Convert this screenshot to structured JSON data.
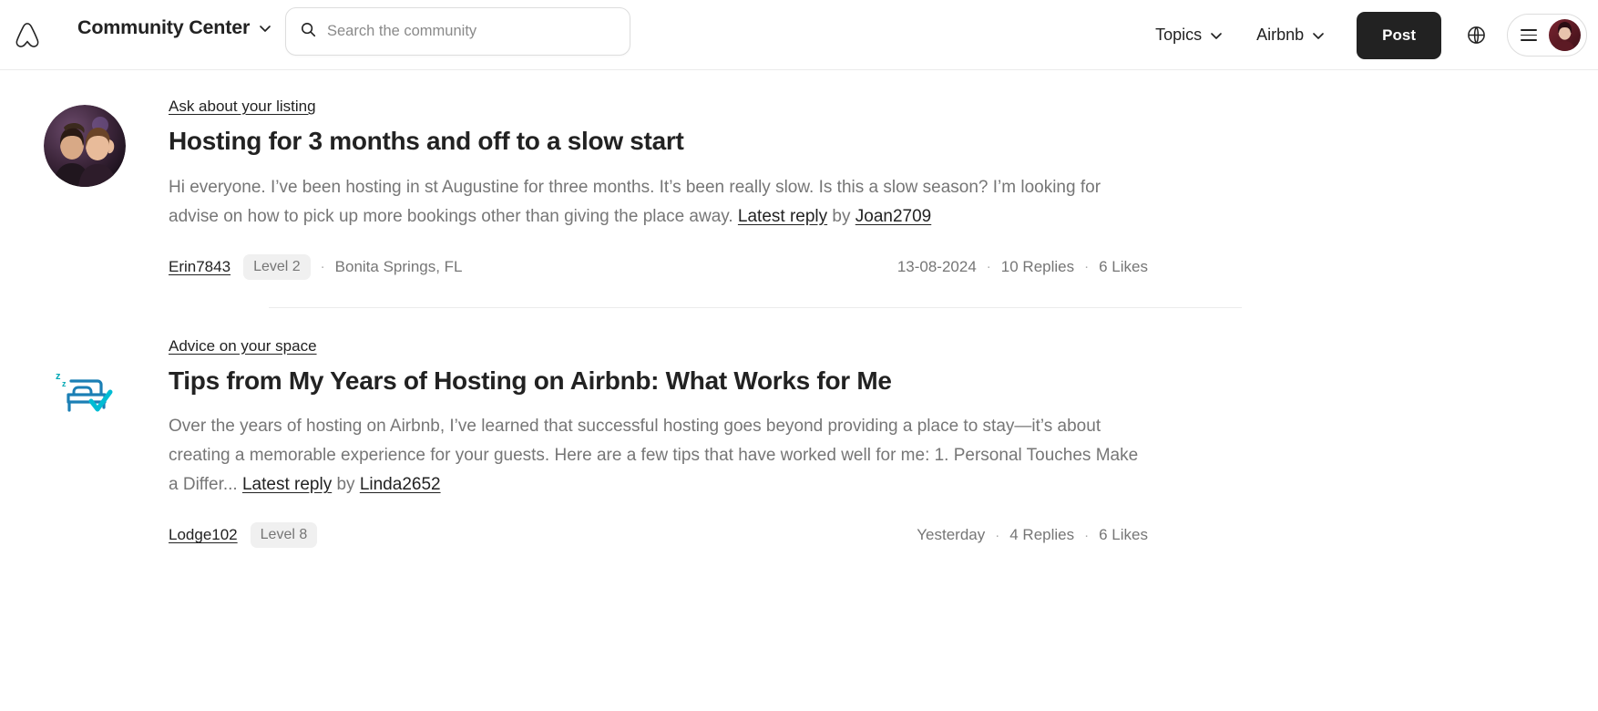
{
  "header": {
    "logo_icon": "airbnb-logo-icon",
    "brand_title": "Community Center",
    "brand_chevron_icon": "chevron-down-icon",
    "search": {
      "icon": "search-icon",
      "placeholder": "Search the community",
      "value": ""
    },
    "nav": [
      {
        "label": "Topics",
        "icon": "chevron-down-icon"
      },
      {
        "label": "Airbnb",
        "icon": "chevron-down-icon"
      }
    ],
    "post_button": "Post",
    "globe_icon": "globe-icon",
    "menu_icon": "hamburger-menu-icon",
    "avatar_icon": "user-avatar"
  },
  "feed": {
    "posts": [
      {
        "media_type": "avatar",
        "category": "Ask about your listing",
        "title": "Hosting for 3 months and off to a slow start",
        "excerpt_text": "Hi everyone. I’ve been hosting in st Augustine for three months. It’s been really slow. Is this a slow season? I’m looking for advise on how to pick up more bookings other than giving the place away. ",
        "latest_reply_label": "Latest reply",
        "by_label": " by ",
        "reply_author": "Joan2709",
        "author": "Erin7843",
        "level": "Level 2",
        "location": "Bonita Springs, FL",
        "date": "13-08-2024",
        "replies": "10 Replies",
        "likes": "6 Likes"
      },
      {
        "media_type": "icon",
        "media_icon": "bed-sleep-check-icon",
        "category": "Advice on your space",
        "title": "Tips from My Years of Hosting on Airbnb: What Works for Me",
        "excerpt_text": "Over the years of hosting on Airbnb, I’ve learned that successful hosting goes beyond providing a place to stay—it’s about creating a memorable experience for your guests. Here are a few tips that have worked well for me: 1. Personal Touches Make a Differ... ",
        "latest_reply_label": "Latest reply",
        "by_label": " by ",
        "reply_author": "Linda2652",
        "author": "Lodge102",
        "level": "Level 8",
        "location": "",
        "date": "Yesterday",
        "replies": "4 Replies",
        "likes": "6 Likes"
      }
    ]
  },
  "colors": {
    "brand": "#FF385C",
    "text": "#222222",
    "muted": "#767676",
    "badge_bg": "#F0F0F0",
    "icon_teal": "#00A8B5",
    "icon_blue": "#1B7FB5"
  }
}
